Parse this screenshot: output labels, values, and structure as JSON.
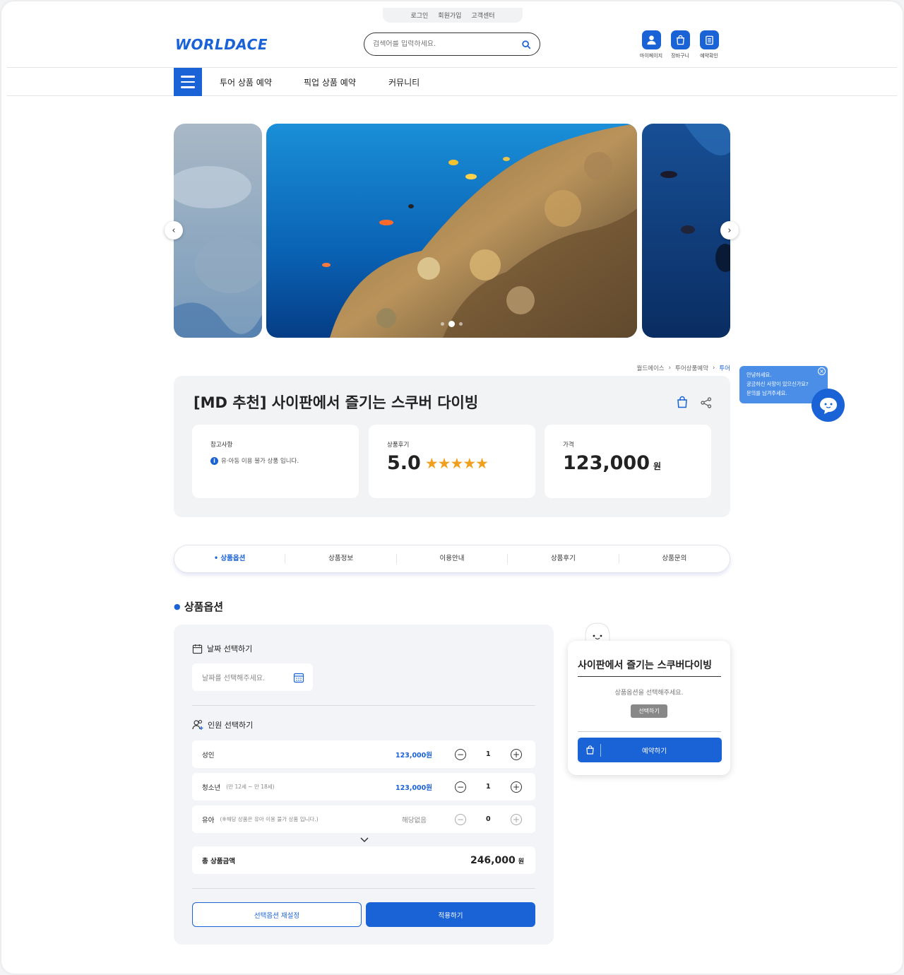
{
  "util": {
    "login": "로그인",
    "signup": "회원가입",
    "support": "고객센터"
  },
  "logo": "WORLDACE",
  "search": {
    "placeholder": "검색어를 입력하세요."
  },
  "quick": {
    "mypage": "마이페이지",
    "cart": "장바구니",
    "reservation": "예약확인"
  },
  "nav": {
    "tour": "투어 상품 예약",
    "pickup": "픽업 상품 예약",
    "community": "커뮤니티"
  },
  "breadcrumb": {
    "home": "월드에이스",
    "category": "투어상품예약",
    "current": "투어"
  },
  "product": {
    "title": "[MD 추천] 사이판에서 즐기는 스쿠버 다이빙",
    "notice_label": "참고사항",
    "notice_text": "유·아동 이용 불가 상품 입니다.",
    "review_label": "상품후기",
    "rating": "5.0",
    "stars": "★★★★★",
    "price_label": "가격",
    "price": "123,000",
    "price_unit": "원"
  },
  "tabs": {
    "options": "• 상품옵션",
    "info": "상품정보",
    "guide": "이용안내",
    "reviews": "상품후기",
    "qna": "상품문의"
  },
  "section_title": "상품옵션",
  "options": {
    "date_title": "날짜 선택하기",
    "date_placeholder": "날짜를 선택해주세요.",
    "people_title": "인원 선택하기",
    "adult": {
      "label": "성인",
      "note": "",
      "price": "123,000원",
      "qty": "1"
    },
    "youth": {
      "label": "청소년",
      "note": "(만 12세 ~ 만 18세)",
      "price": "123,000원",
      "qty": "1"
    },
    "child": {
      "label": "유아",
      "note": "(※해당 상품은 유아 이용 불가 상품 입니다.)",
      "price": "해당없음",
      "qty": "0"
    },
    "total_label": "총 상품금액",
    "total": "246,000",
    "total_unit": "원",
    "reset": "선택옵션 재설정",
    "apply": "적용하기"
  },
  "side": {
    "title": "사이판에서 즐기는 스쿠버다이빙",
    "prompt": "상품옵션을 선택해주세요.",
    "select": "선택하기",
    "book": "예약하기"
  },
  "chat": {
    "line1": "안녕하세요.",
    "line2": "궁금하신 사항이 있으신가요?",
    "line3": "문의를 남겨주세요."
  },
  "colors": {
    "accent": "#1a63d6",
    "star": "#f0a01e"
  }
}
